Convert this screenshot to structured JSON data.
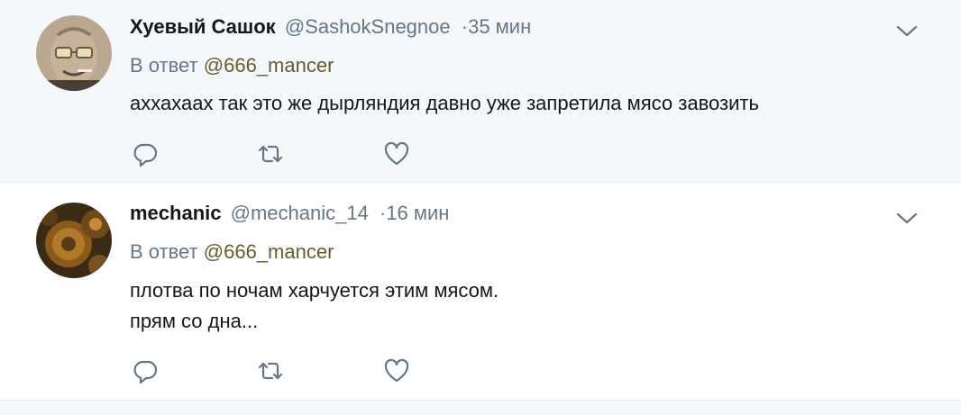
{
  "tweets": [
    {
      "fullname": "Хуевый Сашок",
      "username": "@SashokSnegnoe",
      "time": "·35 мин",
      "reply_label": "В ответ",
      "reply_to": "@666_mancer",
      "lines": [
        "аххахаах так это же дырляндия давно уже запретила мясо завозить"
      ],
      "avatar": "elderly-man-avatar"
    },
    {
      "fullname": "mechanic",
      "username": "@mechanic_14",
      "time": "·16 мин",
      "reply_label": "В ответ",
      "reply_to": "@666_mancer",
      "lines": [
        "плотва по ночам харчуется этим мясом.",
        "прям со дна..."
      ],
      "avatar": "gears-avatar"
    }
  ],
  "icons": {
    "reply": "reply-icon",
    "retweet": "retweet-icon",
    "like": "heart-icon",
    "menu": "chevron-down-icon"
  },
  "colors": {
    "action_icon": "#657786",
    "mention": "#6a5a2c",
    "highlight_bg": "#f5f8fa"
  }
}
